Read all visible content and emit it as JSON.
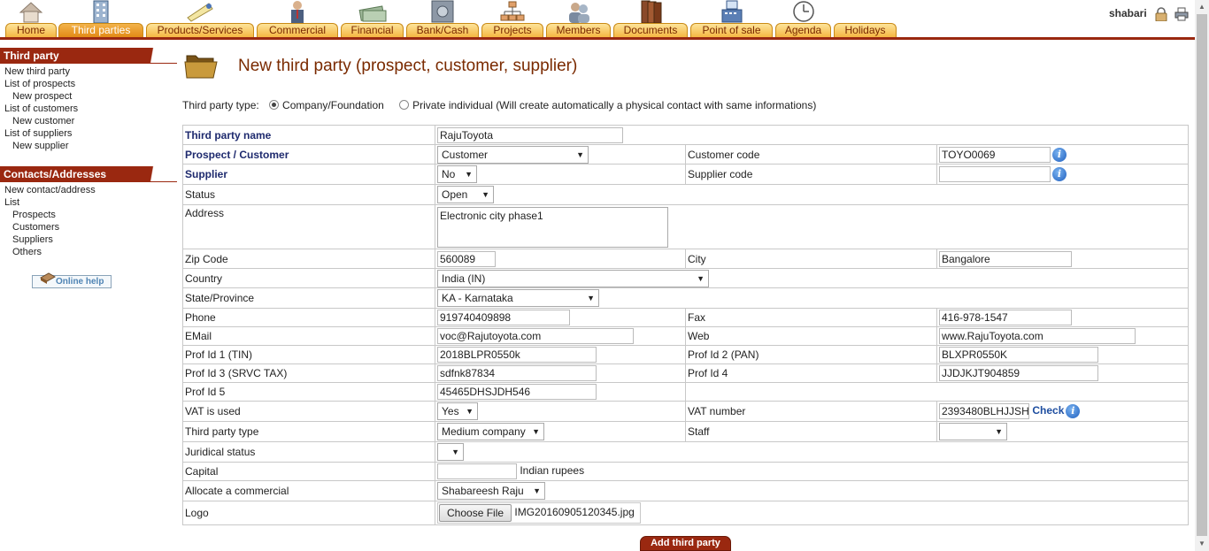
{
  "topbar": {
    "tabs": [
      {
        "label": "Home",
        "icon": "home-icon",
        "active": false
      },
      {
        "label": "Third parties",
        "icon": "building-icon",
        "active": true
      },
      {
        "label": "Products/Services",
        "icon": "products-icon",
        "active": false
      },
      {
        "label": "Commercial",
        "icon": "commercial-icon",
        "active": false
      },
      {
        "label": "Financial",
        "icon": "money-icon",
        "active": false
      },
      {
        "label": "Bank/Cash",
        "icon": "safe-icon",
        "active": false
      },
      {
        "label": "Projects",
        "icon": "projects-icon",
        "active": false
      },
      {
        "label": "Members",
        "icon": "members-icon",
        "active": false
      },
      {
        "label": "Documents",
        "icon": "documents-icon",
        "active": false
      },
      {
        "label": "Point of sale",
        "icon": "cash-register-icon",
        "active": false
      },
      {
        "label": "Agenda",
        "icon": "clock-icon",
        "active": false
      },
      {
        "label": "Holidays",
        "icon": "",
        "active": false
      }
    ],
    "username": "shabari"
  },
  "sidebar": {
    "third_party": {
      "title": "Third party",
      "links": [
        {
          "label": "New third party"
        },
        {
          "label": "List of prospects"
        },
        {
          "label": "New prospect"
        },
        {
          "label": "List of customers"
        },
        {
          "label": "New customer"
        },
        {
          "label": "List of suppliers"
        },
        {
          "label": "New supplier"
        }
      ]
    },
    "contacts": {
      "title": "Contacts/Addresses",
      "links": [
        {
          "label": "New contact/address"
        },
        {
          "label": "List"
        },
        {
          "label": "Prospects"
        },
        {
          "label": "Customers"
        },
        {
          "label": "Suppliers"
        },
        {
          "label": "Others"
        }
      ]
    },
    "online_help": "Online help"
  },
  "page": {
    "title": "New third party (prospect, customer, supplier)",
    "type_label": "Third party type:",
    "type_company": "Company/Foundation",
    "type_individual": "Private individual (Will create automatically a physical contact with same informations)"
  },
  "form": {
    "name": {
      "label": "Third party name",
      "value": "RajuToyota"
    },
    "prospect_customer": {
      "label": "Prospect / Customer",
      "value": "Customer"
    },
    "customer_code": {
      "label": "Customer code",
      "value": "TOYO0069"
    },
    "supplier": {
      "label": "Supplier",
      "value": "No"
    },
    "supplier_code": {
      "label": "Supplier code",
      "value": ""
    },
    "status": {
      "label": "Status",
      "value": "Open"
    },
    "address": {
      "label": "Address",
      "value": "Electronic city phase1"
    },
    "zip": {
      "label": "Zip Code",
      "value": "560089"
    },
    "city": {
      "label": "City",
      "value": "Bangalore"
    },
    "country": {
      "label": "Country",
      "value": "India (IN)"
    },
    "state": {
      "label": "State/Province",
      "value": "KA - Karnataka"
    },
    "phone": {
      "label": "Phone",
      "value": "919740409898"
    },
    "fax": {
      "label": "Fax",
      "value": "416-978-1547"
    },
    "email": {
      "label": "EMail",
      "value": "voc@Rajutoyota.com"
    },
    "web": {
      "label": "Web",
      "value": "www.RajuToyota.com"
    },
    "prof1": {
      "label": "Prof Id 1 (TIN)",
      "value": "2018BLPR0550k"
    },
    "prof2": {
      "label": "Prof Id 2 (PAN)",
      "value": "BLXPR0550K"
    },
    "prof3": {
      "label": "Prof Id 3 (SRVC TAX)",
      "value": "sdfnk87834"
    },
    "prof4": {
      "label": "Prof Id 4",
      "value": "JJDJKJT904859"
    },
    "prof5": {
      "label": "Prof Id 5",
      "value": "45465DHSJDH546"
    },
    "vat_used": {
      "label": "VAT is used",
      "value": "Yes"
    },
    "vat_number": {
      "label": "VAT number",
      "value": "2393480BLHJJSH",
      "check": "Check"
    },
    "tp_type": {
      "label": "Third party type",
      "value": "Medium company"
    },
    "staff": {
      "label": "Staff",
      "value": ""
    },
    "juridical": {
      "label": "Juridical status",
      "value": ""
    },
    "capital": {
      "label": "Capital",
      "value": "",
      "currency": "Indian rupees"
    },
    "commercial": {
      "label": "Allocate a commercial",
      "value": "Shabareesh Raju"
    },
    "logo": {
      "label": "Logo",
      "button": "Choose File",
      "file": "IMG20160905120345.jpg"
    }
  },
  "submit_label": "Add third party",
  "colors": {
    "accent": "#9a2810",
    "tab": "#f5b642",
    "title": "#7a2a00",
    "link_blue": "#1e4ea0"
  }
}
